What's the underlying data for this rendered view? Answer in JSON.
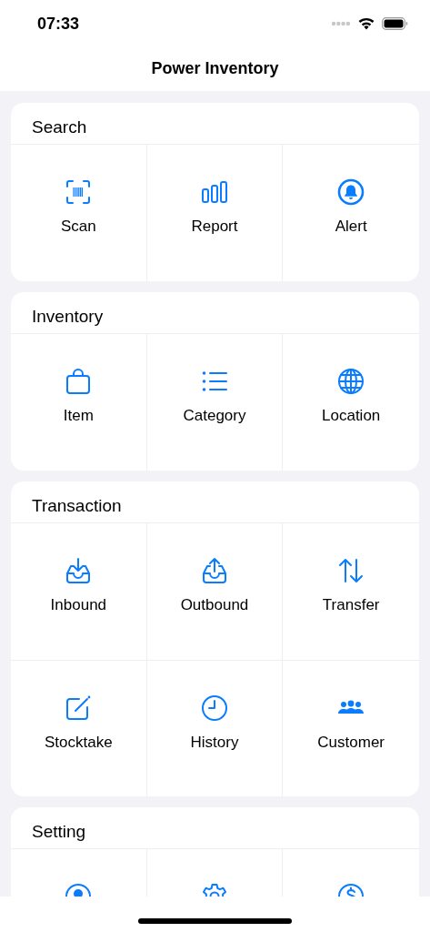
{
  "status_bar": {
    "time": "07:33"
  },
  "nav": {
    "title": "Power Inventory"
  },
  "sections": [
    {
      "title": "Search",
      "items": [
        {
          "label": "Scan"
        },
        {
          "label": "Report"
        },
        {
          "label": "Alert"
        }
      ]
    },
    {
      "title": "Inventory",
      "items": [
        {
          "label": "Item"
        },
        {
          "label": "Category"
        },
        {
          "label": "Location"
        }
      ]
    },
    {
      "title": "Transaction",
      "items": [
        {
          "label": "Inbound"
        },
        {
          "label": "Outbound"
        },
        {
          "label": "Transfer"
        },
        {
          "label": "Stocktake"
        },
        {
          "label": "History"
        },
        {
          "label": "Customer"
        }
      ]
    },
    {
      "title": "Setting"
    }
  ]
}
